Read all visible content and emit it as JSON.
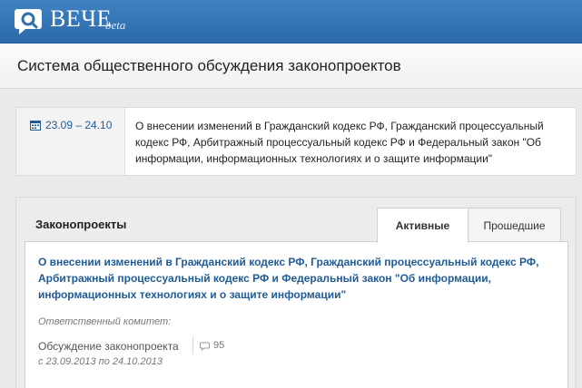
{
  "header": {
    "brand": "ВЕЧЕ",
    "brand_tag": "beta",
    "accent_color": "#3a7bbd"
  },
  "page": {
    "title": "Система общественного обсуждения законопроектов"
  },
  "event": {
    "date_range": "23.09 – 24.10",
    "text": "О внесении изменений в Гражданский кодекс РФ, Гражданский процессуальный кодекс РФ, Арбитражный процессуальный кодекс РФ и Федеральный закон \"Об информации, информационных технологиях и о защите информации\"",
    "icon": "calendar-icon"
  },
  "laws": {
    "title": "Законопроекты",
    "tabs": [
      {
        "label": "Активные",
        "active": true
      },
      {
        "label": "Прошедшие",
        "active": false
      }
    ],
    "items": [
      {
        "title": "О внесении изменений в Гражданский кодекс РФ, Гражданский процессуальный кодекс РФ, Арбитражный процессуальный кодекс РФ и Федеральный закон \"Об информации, информационных технологиях и о защите информации\"",
        "committee_label": "Ответственный комитет:",
        "status": "Обсуждение законопроекта",
        "comments": "95",
        "comments_icon": "comment-icon",
        "period": "с 23.09.2013 по 24.10.2013"
      }
    ]
  }
}
